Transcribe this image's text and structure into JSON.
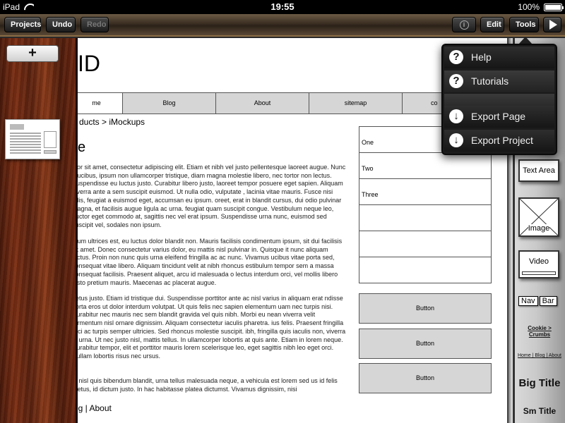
{
  "status": {
    "carrier": "iPad",
    "time": "19:55",
    "battery": "100%"
  },
  "toolbar": {
    "projects": "Projects",
    "undo": "Undo",
    "redo": "Redo",
    "info_icon": "info-icon",
    "edit": "Edit",
    "tools": "Tools",
    "play_icon": "play-icon"
  },
  "left": {
    "add_label": "+"
  },
  "canvas": {
    "logo": "ID",
    "nav": [
      "me",
      "Blog",
      "About",
      "sitemap",
      "co"
    ],
    "breadcrumb": "ducts > iMockups",
    "heading": "e",
    "paragraphs": [
      "olor sit amet, consectetur adipiscing elit. Etiam et nibh vel justo pellentesque laoreet augue. Nunc faucibus, ipsum non ullamcorper tristique, diam magna molestie libero, nec tortor non lectus. Suspendisse eu luctus justo. Curabitur libero justo, laoreet tempor posuere eget sapien. Aliquam viverra ante a sem suscipit euismod. Ut nulla odio, vulputate , lacinia vitae mauris. Fusce nisi felis, feugiat a euismod eget, accumsan eu ipsum. oreet, erat in blandit cursus, dui odio pulvinar magna, et facilisis augue ligula ac urna. feugiat quam suscipit congue. Vestibulum neque leo, auctor eget commodo at, sagittis nec vel erat ipsum. Suspendisse urna nunc, euismod sed suscipit vel, sodales non ipsum.",
      "ntum ultrices est, eu luctus dolor blandit non. Mauris facilisis condimentum ipsum, sit dui facilisis sit amet. Donec consectetur varius dolor, eu mattis nisl pulvinar in. Quisque it nunc aliquam luctus. Proin non nunc quis urna eleifend fringilla ac ac nunc. Vivamus ucibus vitae porta sed, consequat vitae libero. Aliquam tincidunt velit at nibh rhoncus estibulum tempor sem a massa consequat facilisis. Praesent aliquet, arcu id malesuada o lectus interdum orci, vel mollis libero justo pretium mauris. Maecenas ac placerat augue.",
      "netus justo. Etiam id tristique dui. Suspendisse porttitor ante ac nisl varius in aliquam erat ndisse porta eros ut dolor interdum volutpat. Ut quis felis nec sapien elementum uam nec turpis nisi. Curabitur nec mauris nec sem blandit gravida vel quis nibh. Morbi eu nean viverra velit fermentum nisl ornare dignissim. Aliquam consectetur iaculis pharetra. ius felis. Praesent fringilla orci ac turpis semper ultricies. Sed rhoncus molestie suscipit. ibh, fringilla quis iaculis non, viverra in urna. Ut nec justo nisl, mattis tellus. In ullamcorper lobortis at quis ante. Etiam in lorem neque. Curabitur tempor, elit et porttitor mauris lorem scelerisque leo, eget sagittis nibh leo eget orci. Nullam lobortis risus nec ursus.",
      "s, nisl quis bibendum blandit, urna tellus malesuada neque, a vehicula est lorem sed us id felis metus, id dictum justo. In hac habitasse platea dictumst. Vivamus dignissim, nisi"
    ],
    "footer": "og | About",
    "list": [
      "One",
      "Two",
      "Three",
      "",
      "",
      ""
    ],
    "buttons": [
      "Button",
      "Button",
      "Button"
    ]
  },
  "palette": {
    "text_area": "Text Area",
    "image": "Image",
    "video": "Video",
    "nav": [
      "Nav",
      "Bar"
    ],
    "crumbs": "Cookie > Crumbs",
    "links": "Home | Blog | About",
    "big_title": "Big Title",
    "sm_title": "Sm Title"
  },
  "menu": {
    "items": [
      {
        "label": "Help",
        "icon": "question-icon"
      },
      {
        "label": "Tutorials",
        "icon": "question-icon"
      },
      {
        "label": "Export Page",
        "icon": "download-icon"
      },
      {
        "label": "Export Project",
        "icon": "download-icon"
      }
    ]
  }
}
